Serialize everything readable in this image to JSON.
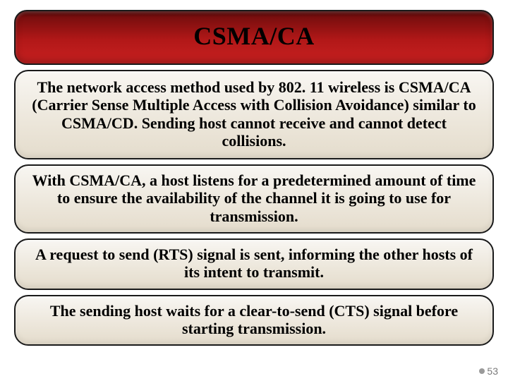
{
  "title": "CSMA/CA",
  "paragraphs": [
    "The network access method used by 802. 11 wireless is CSMA/CA (Carrier Sense Multiple Access with Collision Avoidance) similar to CSMA/CD. Sending host cannot receive and cannot detect collisions.",
    "With CSMA/CA, a host listens for a predetermined amount of time to ensure the availability of the channel it is going to use for transmission.",
    "A request to send (RTS) signal is sent, informing the other hosts of its intent to transmit.",
    "The sending host waits for a clear-to-send (CTS) signal before starting transmission."
  ],
  "page_number": "53"
}
